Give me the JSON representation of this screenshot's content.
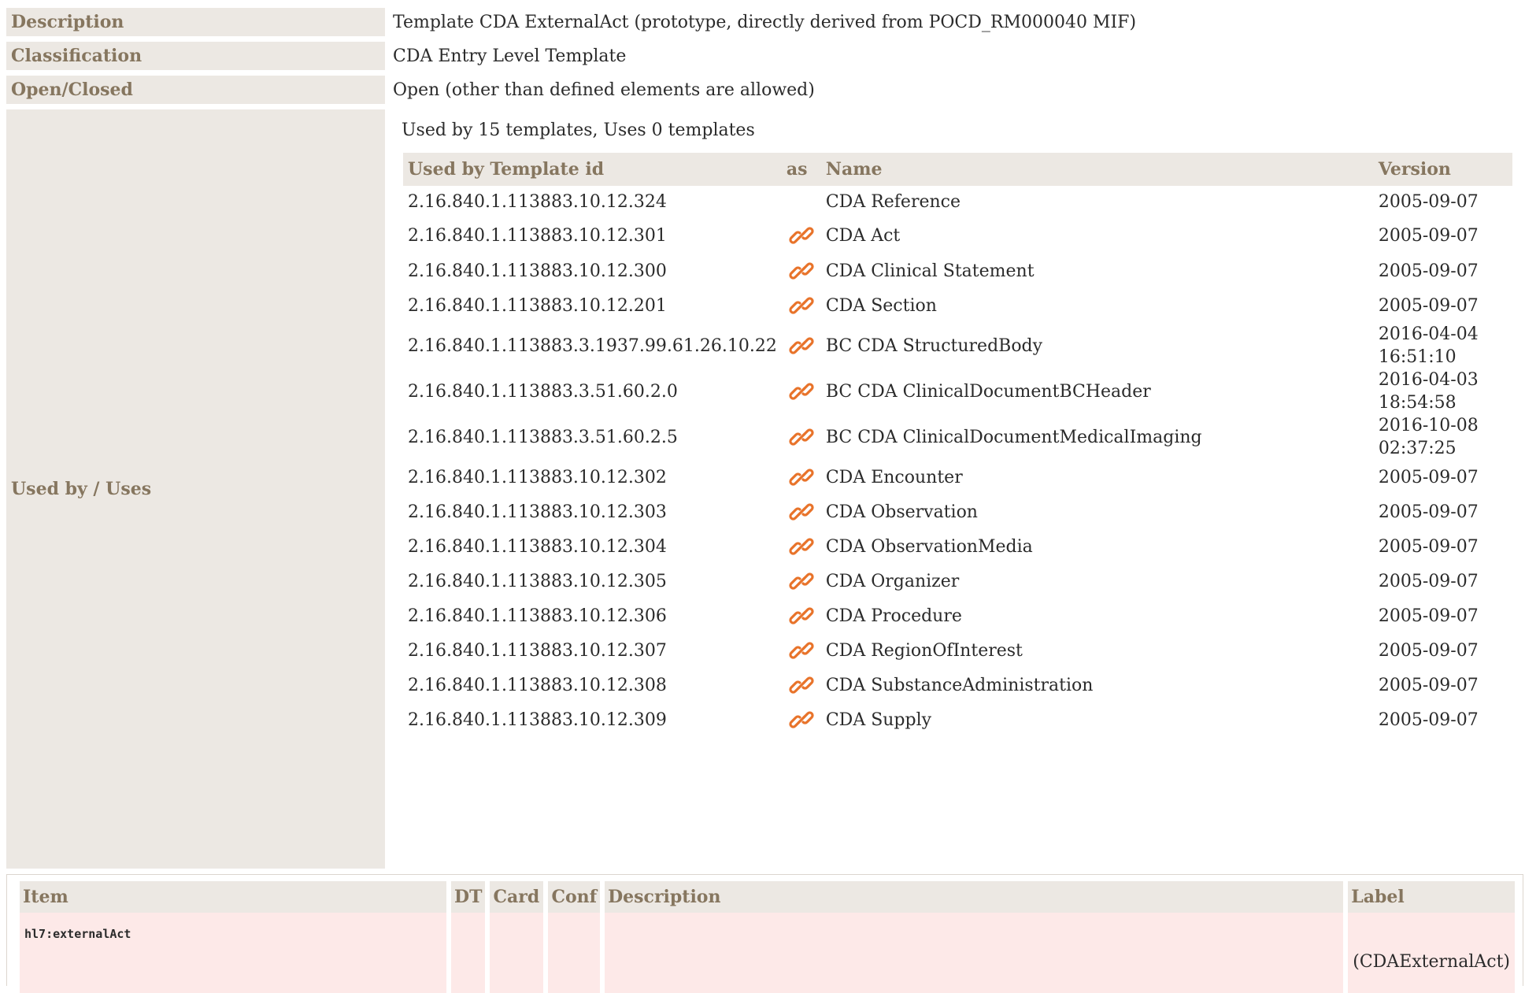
{
  "meta": {
    "description_key": "Description",
    "description_val": "Template CDA ExternalAct (prototype, directly derived from POCD_RM000040 MIF)",
    "classification_key": "Classification",
    "classification_val": "CDA Entry Level Template",
    "open_key": "Open/Closed",
    "open_val": "Open (other than defined elements are allowed)",
    "usedby_key": "Used by / Uses"
  },
  "usedby": {
    "summary": "Used by 15 templates, Uses 0 templates",
    "headers": {
      "id": "Used by Template id",
      "as": "as",
      "name": "Name",
      "version": "Version"
    },
    "link_icon": "link-icon",
    "link_color": "#e8732a",
    "rows": [
      {
        "id": "2.16.840.1.113883.10.12.324",
        "icon": false,
        "name": "CDA Reference",
        "version": "2005-09-07"
      },
      {
        "id": "2.16.840.1.113883.10.12.301",
        "icon": true,
        "name": "CDA Act",
        "version": "2005-09-07"
      },
      {
        "id": "2.16.840.1.113883.10.12.300",
        "icon": true,
        "name": "CDA Clinical Statement",
        "version": "2005-09-07"
      },
      {
        "id": "2.16.840.1.113883.10.12.201",
        "icon": true,
        "name": "CDA Section",
        "version": "2005-09-07"
      },
      {
        "id": "2.16.840.1.113883.3.1937.99.61.26.10.22",
        "icon": true,
        "name": "BC CDA StructuredBody",
        "version": "2016-04-04",
        "version_time": "16:51:10"
      },
      {
        "id": "2.16.840.1.113883.3.51.60.2.0",
        "icon": true,
        "name": "BC CDA ClinicalDocumentBCHeader",
        "version": "2016-04-03",
        "version_time": "18:54:58"
      },
      {
        "id": "2.16.840.1.113883.3.51.60.2.5",
        "icon": true,
        "name": "BC CDA ClinicalDocumentMedicalImaging",
        "version": "2016-10-08",
        "version_time": "02:37:25"
      },
      {
        "id": "2.16.840.1.113883.10.12.302",
        "icon": true,
        "name": "CDA Encounter",
        "version": "2005-09-07"
      },
      {
        "id": "2.16.840.1.113883.10.12.303",
        "icon": true,
        "name": "CDA Observation",
        "version": "2005-09-07"
      },
      {
        "id": "2.16.840.1.113883.10.12.304",
        "icon": true,
        "name": "CDA ObservationMedia",
        "version": "2005-09-07"
      },
      {
        "id": "2.16.840.1.113883.10.12.305",
        "icon": true,
        "name": "CDA Organizer",
        "version": "2005-09-07"
      },
      {
        "id": "2.16.840.1.113883.10.12.306",
        "icon": true,
        "name": "CDA Procedure",
        "version": "2005-09-07"
      },
      {
        "id": "2.16.840.1.113883.10.12.307",
        "icon": true,
        "name": "CDA RegionOfInterest",
        "version": "2005-09-07"
      },
      {
        "id": "2.16.840.1.113883.10.12.308",
        "icon": true,
        "name": "CDA SubstanceAdministration",
        "version": "2005-09-07"
      },
      {
        "id": "2.16.840.1.113883.10.12.309",
        "icon": true,
        "name": "CDA Supply",
        "version": "2005-09-07"
      }
    ]
  },
  "items": {
    "headers": {
      "item": "Item",
      "dt": "DT",
      "card": "Card",
      "conf": "Conf",
      "description": "Description",
      "label": "Label"
    },
    "row": {
      "item": "hl7:externalAct",
      "dt": "",
      "card": "",
      "conf": "",
      "description": "",
      "label": "(CDAExternalAct)"
    }
  },
  "colors": {
    "header_bg": "#ece8e3",
    "header_text": "#86765f",
    "item_row_bg": "#fde9e8"
  }
}
